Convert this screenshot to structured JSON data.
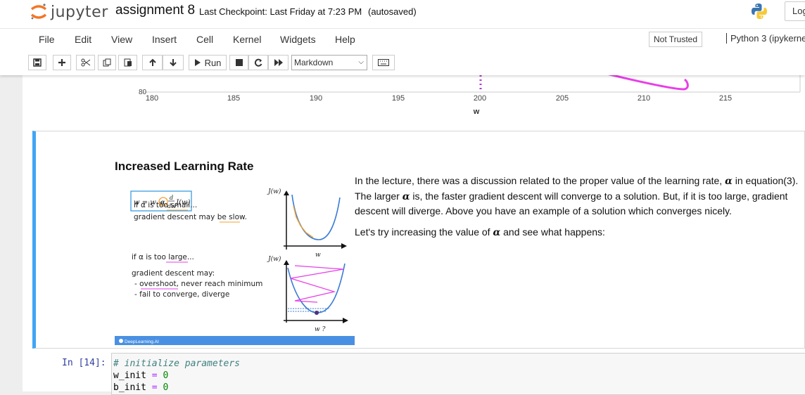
{
  "header": {
    "logo_text": "jupyter",
    "notebook_name": "assignment 8",
    "checkpoint": "Last Checkpoint: Last Friday at 7:23 PM",
    "autosave": "(autosaved)",
    "logout_label": "Log"
  },
  "menu": {
    "items": [
      "File",
      "Edit",
      "View",
      "Insert",
      "Cell",
      "Kernel",
      "Widgets",
      "Help"
    ],
    "trusted": "Not Trusted",
    "kernel": "Python 3 (ipykerne"
  },
  "toolbar": {
    "icons": [
      "save-icon",
      "plus-icon",
      "cut-icon",
      "copy-icon",
      "paste-icon",
      "arrow-up-icon",
      "arrow-down-icon",
      "play-icon",
      "stop-icon",
      "restart-icon",
      "fast-forward-icon",
      "keyboard-icon"
    ],
    "run_label": "Run",
    "cell_type": "Markdown"
  },
  "plot": {
    "y_tick_visible": "80",
    "x_ticks": [
      "180",
      "185",
      "190",
      "195",
      "200",
      "205",
      "210",
      "215"
    ],
    "xlabel": "w"
  },
  "markdown_cell": {
    "title": "Increased Learning Rate",
    "para1_a": "In the lecture, there was a discussion related to the proper value of the learning rate, ",
    "alpha": "α",
    "para1_b": " in equation(3). The larger ",
    "para1_c": " is, the faster gradient descent will converge to a solution. But, if it is too large, gradient descent will diverge. Above you have an example of a solution which converges nicely.",
    "para2_a": "Let's try increasing the value of ",
    "para2_b": " and see what happens:",
    "slide": {
      "formula_lhs": "w = w −",
      "formula_alpha": "α",
      "formula_frac_num": "d",
      "formula_frac_den": "dw",
      "formula_rhs": "J(w)",
      "small_line1": "if α is too small...",
      "small_line2": "gradient descent may be slow.",
      "large_line1": "if α is too large...",
      "large_line2": "gradient descent may:",
      "large_line3": "- overshoot, never reach minimum",
      "large_line4": "- fail to converge, diverge",
      "axis_y": "J(w)",
      "axis_x": "w",
      "axis_x2": "w ?",
      "footer": "DeepLearning.AI",
      "colors": {
        "curve": "#3a7bd5",
        "steps_small": "#f0a030",
        "steps_large": "#e83ee8",
        "footer_bar": "#4a90e2"
      }
    }
  },
  "code_cell": {
    "prompt": "In [14]:",
    "line1": "# initialize parameters",
    "line2_var": "w_init",
    "line2_op": " = ",
    "line2_val": "0",
    "line3_var": "b_init",
    "line3_op": " = ",
    "line3_val": "0"
  }
}
